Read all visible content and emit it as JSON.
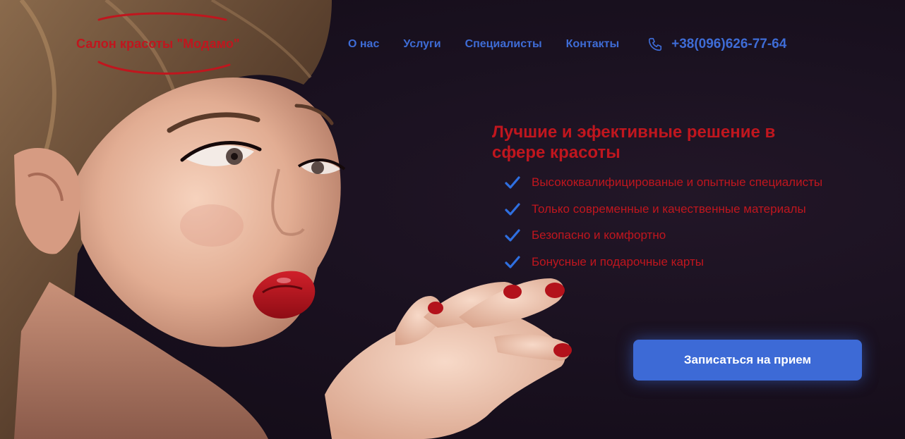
{
  "brand": {
    "logo_text": "Салон красоты \"Модамо\"",
    "color": "#c0161e"
  },
  "nav": {
    "items": [
      {
        "label": "О нас"
      },
      {
        "label": "Услуги"
      },
      {
        "label": "Специалисты"
      },
      {
        "label": "Контакты"
      }
    ],
    "phone": "+38(096)626-77-64",
    "phone_icon": "phone-icon",
    "color": "#3e6cd6"
  },
  "hero": {
    "headline": "Лучшие и эфективные решение в сфере красоты",
    "features": [
      "Высококвалифицированые и опытные специалисты",
      "Только современные и качественные материалы",
      "Безопасно и комфортно",
      "Бонусные и подарочные карты"
    ],
    "feature_icon": "check-icon",
    "cta_label": "Записаться на прием",
    "cta_color": "#3d6ad6"
  }
}
